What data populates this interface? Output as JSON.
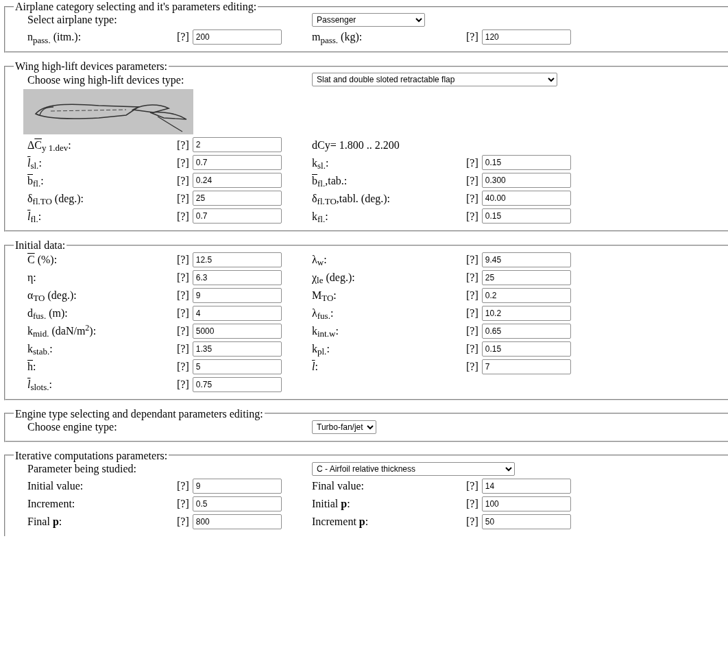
{
  "sections": [
    {
      "legend": "Airplane category selecting and it's parameters editing:",
      "rows": [
        {
          "kind": "choice",
          "label": {
            "text": "Select airplane type:"
          },
          "value": "Passenger"
        },
        {
          "kind": "params",
          "items": [
            {
              "kind": "param",
              "label": {
                "text": "n$_{pass.}$ (itm.):"
              },
              "help": "[?]",
              "value": "200"
            },
            {
              "kind": "param",
              "label": {
                "text": "m$_{pass.}$ (kg):"
              },
              "help": "[?]",
              "value": "120"
            }
          ]
        }
      ]
    },
    {
      "legend": "Wing high-lift devices parameters:",
      "rows": [
        {
          "kind": "choice",
          "label": {
            "text": "Choose wing high-lift devices type:"
          },
          "value": "Slat and double sloted retractable flap"
        },
        {
          "kind": "picture"
        },
        {
          "kind": "params",
          "items": [
            {
              "kind": "param",
              "label": {
                "prefix": "Δ",
                "symbol": "C",
                "bar": true,
                "text": "$_{y 1.dev}$:"
              },
              "help": "[?]",
              "value": "2"
            },
            {
              "kind": "note",
              "text": "dCy= 1.800 .. 2.200"
            }
          ]
        },
        {
          "kind": "params",
          "items": [
            {
              "kind": "param",
              "label": {
                "symbol": "l",
                "bar": true,
                "italic": true,
                "text": "$_{sl.}$:"
              },
              "help": "[?]",
              "value": "0.7"
            },
            {
              "kind": "param",
              "label": {
                "text": "k$_{sl.}$:"
              },
              "help": "[?]",
              "value": "0.15"
            }
          ]
        },
        {
          "kind": "params",
          "items": [
            {
              "kind": "param",
              "label": {
                "symbol": "b",
                "bar": true,
                "text": "$_{fl.}$:"
              },
              "help": "[?]",
              "value": "0.24"
            },
            {
              "kind": "param",
              "label": {
                "symbol": "b",
                "bar": true,
                "text": "$_{fl.}$,tab.:"
              },
              "help": "[?]",
              "value": "0.300"
            }
          ]
        },
        {
          "kind": "params",
          "items": [
            {
              "kind": "param",
              "label": {
                "text": "δ$_{fl.TO}$ (deg.):"
              },
              "help": "[?]",
              "value": "25"
            },
            {
              "kind": "param",
              "label": {
                "text": "δ$_{fl.TO}$,tabl. (deg.):"
              },
              "help": "[?]",
              "value": "40.00"
            }
          ]
        },
        {
          "kind": "params",
          "items": [
            {
              "kind": "param",
              "label": {
                "symbol": "l",
                "bar": true,
                "italic": true,
                "text": "$_{fl.}$:"
              },
              "help": "[?]",
              "value": "0.7"
            },
            {
              "kind": "param",
              "label": {
                "text": "k$_{fl.}$:"
              },
              "help": "[?]",
              "value": "0.15"
            }
          ]
        }
      ]
    },
    {
      "legend": "Initial data:",
      "rows": [
        {
          "kind": "params",
          "items": [
            {
              "kind": "param",
              "label": {
                "symbol": "C",
                "bar": true,
                "text": " (%):"
              },
              "help": "[?]",
              "value": "12.5"
            },
            {
              "kind": "param",
              "label": {
                "text": "λ$_{w}$:"
              },
              "help": "[?]",
              "value": "9.45"
            }
          ]
        },
        {
          "kind": "params",
          "items": [
            {
              "kind": "param",
              "label": {
                "text": "η:"
              },
              "help": "[?]",
              "value": "6.3"
            },
            {
              "kind": "param",
              "label": {
                "text": "χ$_{le}$ (deg.):"
              },
              "help": "[?]",
              "value": "25"
            }
          ]
        },
        {
          "kind": "params",
          "items": [
            {
              "kind": "param",
              "label": {
                "text": "α$_{TO}$ (deg.):"
              },
              "help": "[?]",
              "value": "9"
            },
            {
              "kind": "param",
              "label": {
                "text": "M$_{TO}$:"
              },
              "help": "[?]",
              "value": "0.2"
            }
          ]
        },
        {
          "kind": "params",
          "items": [
            {
              "kind": "param",
              "label": {
                "text": "d$_{fus.}$ (m):"
              },
              "help": "[?]",
              "value": "4"
            },
            {
              "kind": "param",
              "label": {
                "text": "λ$_{fus.}$:"
              },
              "help": "[?]",
              "value": "10.2"
            }
          ]
        },
        {
          "kind": "params",
          "items": [
            {
              "kind": "param",
              "label": {
                "text": "k$_{mid.}$ (daN/m$^{2}$):"
              },
              "help": "[?]",
              "value": "5000"
            },
            {
              "kind": "param",
              "label": {
                "text": "k$_{int.w}$:"
              },
              "help": "[?]",
              "value": "0.65"
            }
          ]
        },
        {
          "kind": "params",
          "items": [
            {
              "kind": "param",
              "label": {
                "text": "k$_{stab.}$:"
              },
              "help": "[?]",
              "value": "1.35"
            },
            {
              "kind": "param",
              "label": {
                "text": "k$_{pl.}$:"
              },
              "help": "[?]",
              "value": "0.15"
            }
          ]
        },
        {
          "kind": "params",
          "items": [
            {
              "kind": "param",
              "label": {
                "symbol": "h",
                "bar": true,
                "text": ":"
              },
              "help": "[?]",
              "value": "5"
            },
            {
              "kind": "param",
              "label": {
                "symbol": "l",
                "bar": true,
                "italic": true,
                "text": ":"
              },
              "help": "[?]",
              "value": "7"
            }
          ]
        },
        {
          "kind": "params",
          "items": [
            {
              "kind": "param",
              "label": {
                "symbol": "l",
                "bar": true,
                "italic": true,
                "text": "$_{slots.}$:"
              },
              "help": "[?]",
              "value": "0.75"
            }
          ]
        }
      ]
    },
    {
      "legend": "Engine type selecting and dependant parameters editing:",
      "rows": [
        {
          "kind": "choice",
          "label": {
            "text": "Choose engine type:"
          },
          "value": "Turbo-fan/jet"
        }
      ]
    },
    {
      "legend": "Iterative computations parameters:",
      "rows": [
        {
          "kind": "choice",
          "label": {
            "text": "Parameter being studied:"
          },
          "value": "C - Airfoil relative thickness"
        },
        {
          "kind": "params",
          "items": [
            {
              "kind": "param",
              "label": {
                "text": "Initial value:"
              },
              "help": "[?]",
              "value": "9"
            },
            {
              "kind": "param",
              "label": {
                "text": "Final value:"
              },
              "help": "[?]",
              "value": "14"
            }
          ]
        },
        {
          "kind": "params",
          "items": [
            {
              "kind": "param",
              "label": {
                "text": "Increment:"
              },
              "help": "[?]",
              "value": "0.5"
            },
            {
              "kind": "param",
              "label": {
                "text": "Initial **p**:"
              },
              "help": "[?]",
              "value": "100"
            }
          ]
        },
        {
          "kind": "params",
          "items": [
            {
              "kind": "param",
              "label": {
                "text": "Final **p**:"
              },
              "help": "[?]",
              "value": "800"
            },
            {
              "kind": "param",
              "label": {
                "text": "Increment **p**:"
              },
              "help": "[?]",
              "value": "50"
            }
          ]
        }
      ]
    }
  ]
}
